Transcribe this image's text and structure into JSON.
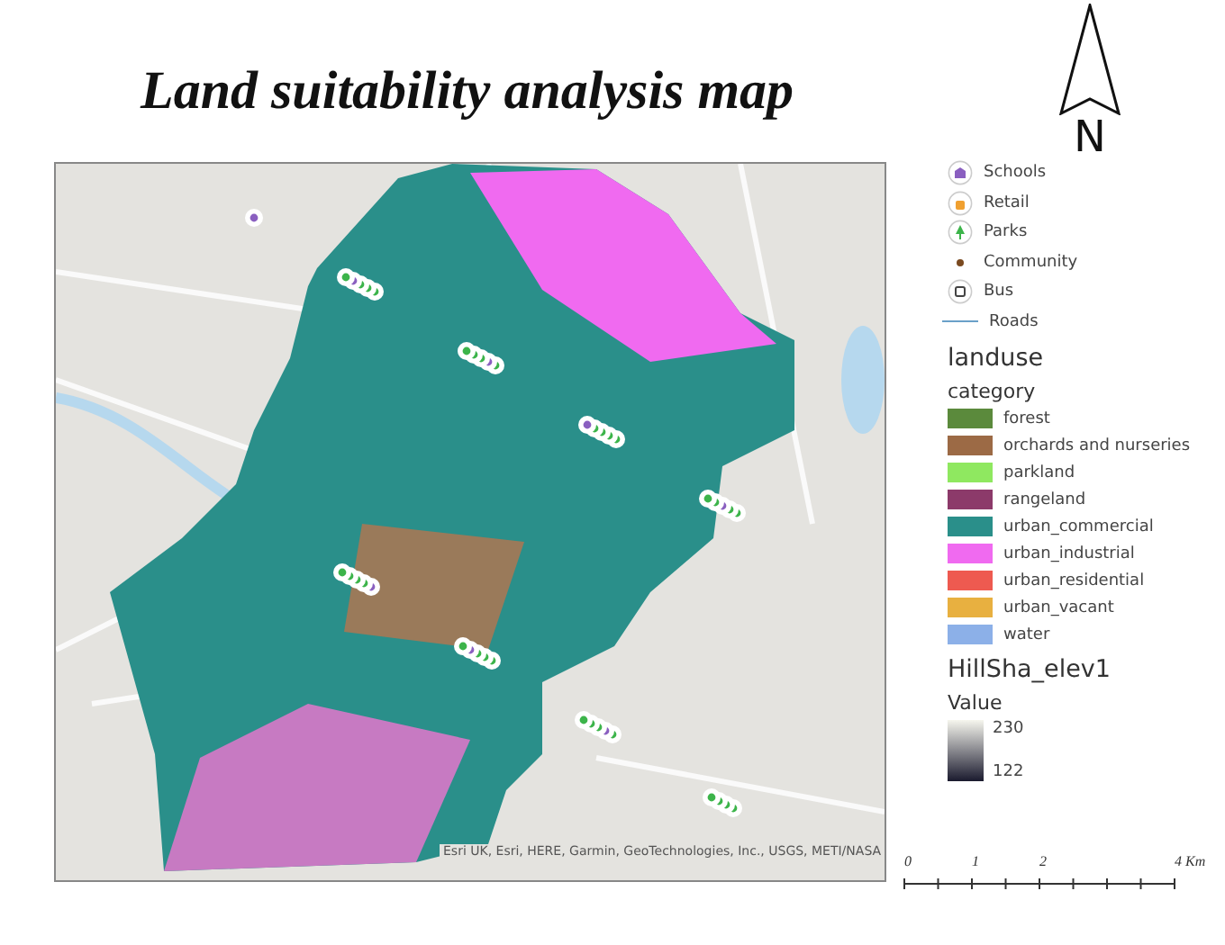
{
  "title": "Land suitability analysis map",
  "north_arrow": {
    "label": "N"
  },
  "map": {
    "attribution": "Esri UK, Esri, HERE, Garmin, GeoTechnologies, Inc., USGS, METI/NASA"
  },
  "legend": {
    "point_layers": [
      {
        "kind": "school",
        "label": "Schools"
      },
      {
        "kind": "retail",
        "label": "Retail"
      },
      {
        "kind": "park",
        "label": "Parks"
      },
      {
        "kind": "community",
        "label": "Community"
      },
      {
        "kind": "bus",
        "label": "Bus"
      },
      {
        "kind": "road",
        "label": "Roads"
      }
    ],
    "landuse": {
      "title": "landuse",
      "field": "category",
      "classes": [
        {
          "label": "forest",
          "color": "#5b8a3c"
        },
        {
          "label": "orchards and nurseries",
          "color": "#9c6a45"
        },
        {
          "label": "parkland",
          "color": "#8fe860"
        },
        {
          "label": "rangeland",
          "color": "#8c3a6a"
        },
        {
          "label": "urban_commercial",
          "color": "#2a8f8a"
        },
        {
          "label": "urban_industrial",
          "color": "#f06af0"
        },
        {
          "label": "urban_residential",
          "color": "#ee5a50"
        },
        {
          "label": "urban_vacant",
          "color": "#e8b040"
        },
        {
          "label": "water",
          "color": "#8cb0e8"
        }
      ]
    },
    "hillshade": {
      "title": "HillSha_elev1",
      "field": "Value",
      "high": "230",
      "low": "122"
    }
  },
  "scale_bar": {
    "ticks": [
      "0",
      "1",
      "2",
      "4 Km"
    ]
  }
}
